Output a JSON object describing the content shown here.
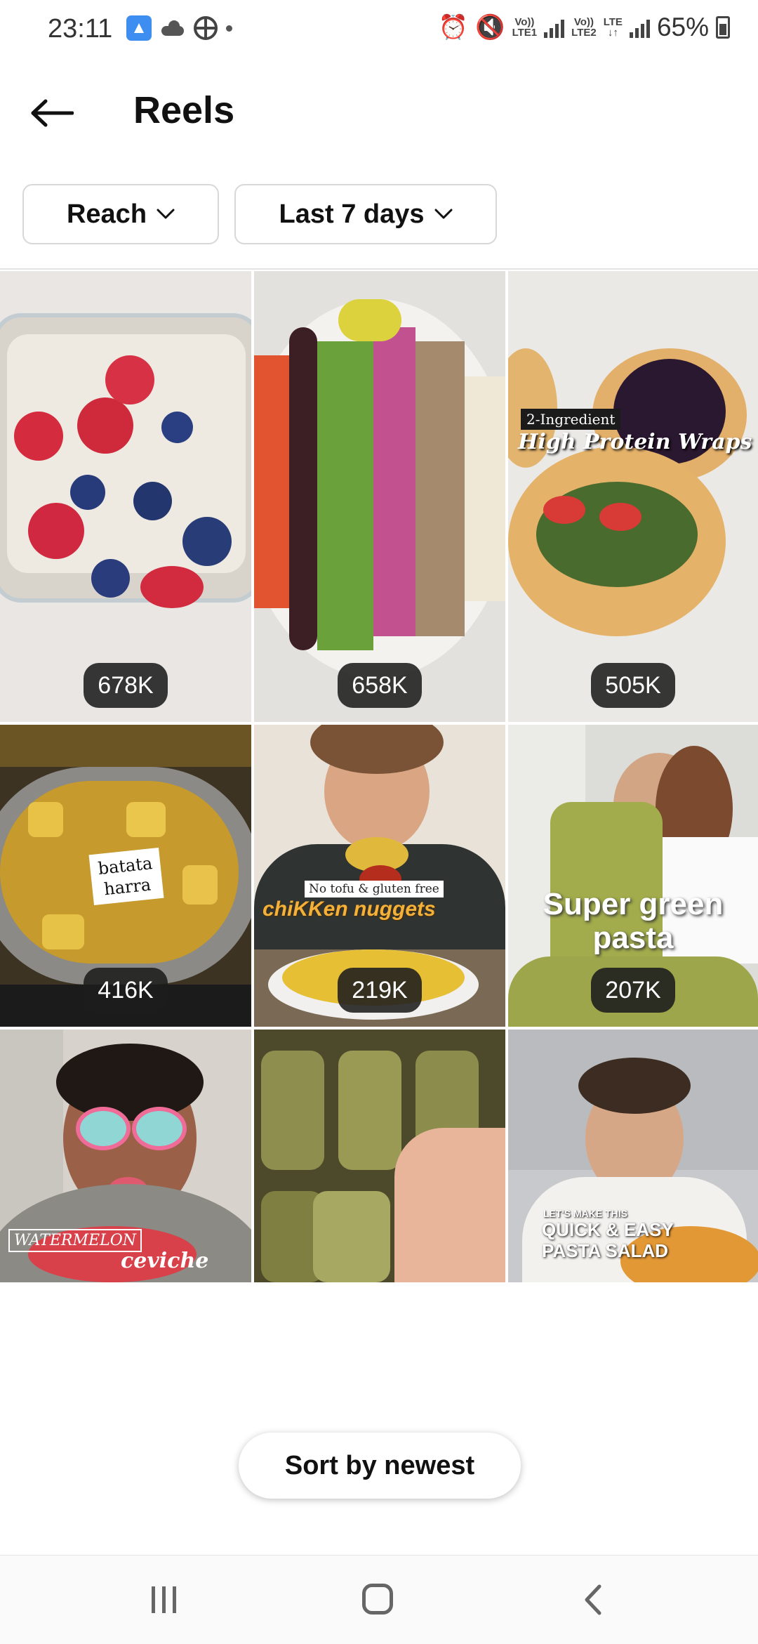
{
  "status_bar": {
    "time": "23:11",
    "network_1_top": "Vo))",
    "network_1_bottom": "LTE1",
    "network_2_top": "Vo))",
    "network_2_bottom": "LTE2",
    "network_lte": "LTE",
    "battery_percent": "65%"
  },
  "header": {
    "title": "Reels",
    "back_icon": "arrow-left-icon"
  },
  "filters": {
    "metric": {
      "label": "Reach",
      "icon": "chevron-down-icon"
    },
    "period": {
      "label": "Last 7 days",
      "icon": "chevron-down-icon"
    }
  },
  "reels": [
    {
      "count": "678K"
    },
    {
      "count": "658K"
    },
    {
      "count": "505K",
      "overlay_small": "2-Ingredient",
      "overlay_title": "High Protein Wraps"
    },
    {
      "count": "416K",
      "overlay_label_line1": "batata",
      "overlay_label_line2": "harra"
    },
    {
      "count": "219K",
      "overlay_small": "No tofu & gluten free",
      "overlay_title": "chiKKen nuggets"
    },
    {
      "count": "207K",
      "overlay_line1": "Super green",
      "overlay_line2": "pasta"
    },
    {
      "overlay_line1": "WATERMELON",
      "overlay_line2": "ceviche"
    },
    {},
    {
      "overlay_small": "LET'S MAKE THIS",
      "overlay_line1": "QUICK & EASY",
      "overlay_line2": "PASTA SALAD"
    }
  ],
  "sort_button": {
    "label": "Sort by newest"
  },
  "nav_bar": {
    "recents_icon": "recents-icon",
    "home_icon": "home-icon",
    "back_icon": "back-icon"
  },
  "colors": {
    "pill_bg": "#1c1c1c",
    "border": "#d8d8d8"
  }
}
